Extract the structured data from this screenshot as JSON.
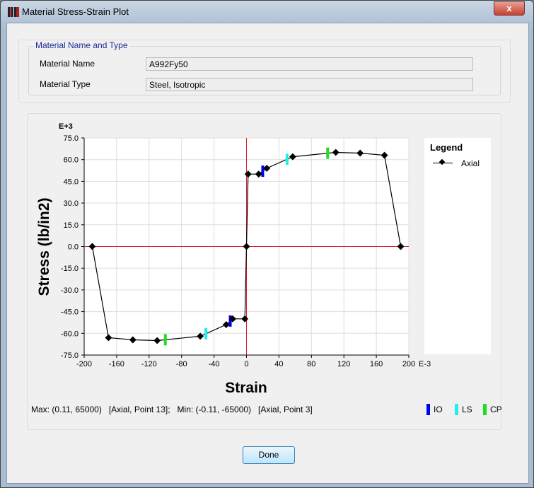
{
  "window": {
    "title": "Material Stress-Strain Plot",
    "close_label": "x"
  },
  "group": {
    "title": "Material Name and Type",
    "name_label": "Material Name",
    "name_value": "A992Fy50",
    "type_label": "Material Type",
    "type_value": "Steel, Isotropic"
  },
  "summary": "Max: (0.11, 65000)   [Axial, Point 13];   Min: (-0.11, -65000)   [Axial, Point 3]",
  "hinge_legend": [
    {
      "label": "IO",
      "color": "#0000ee"
    },
    {
      "label": "LS",
      "color": "#22eeee"
    },
    {
      "label": "CP",
      "color": "#22dd22"
    }
  ],
  "done_label": "Done",
  "chart_data": {
    "type": "line",
    "xlabel": "Strain",
    "ylabel": "Stress (lb/in2)",
    "x_exponent": "E-3",
    "y_exponent": "E+3",
    "xlim": [
      -200,
      200
    ],
    "ylim": [
      -75,
      75
    ],
    "xticks": [
      "-200",
      "-160",
      "-120",
      "-80",
      "-40",
      "0",
      "40",
      "80",
      "120",
      "160",
      "200"
    ],
    "yticks": [
      "75.0",
      "60.0",
      "45.0",
      "30.0",
      "15.0",
      "0.0",
      "-15.0",
      "-30.0",
      "-45.0",
      "-60.0",
      "-75.0"
    ],
    "grid": true,
    "legend": {
      "title": "Legend",
      "position": "right"
    },
    "series": [
      {
        "name": "Axial",
        "color": "#000000",
        "x": [
          -190,
          -170,
          -140,
          -110,
          -57,
          -25,
          -17,
          -2,
          0,
          2,
          15,
          25,
          57,
          110,
          140,
          170,
          190
        ],
        "y": [
          0,
          -63,
          -64.5,
          -65,
          -62,
          -54,
          -50,
          -50,
          0,
          50,
          50,
          54,
          62,
          65,
          64.5,
          63,
          0
        ]
      }
    ],
    "hinge_markers": [
      {
        "type": "IO",
        "x": [
          -20,
          20
        ]
      },
      {
        "type": "LS",
        "x": [
          -50,
          50
        ]
      },
      {
        "type": "CP",
        "x": [
          -100,
          100
        ]
      }
    ]
  }
}
